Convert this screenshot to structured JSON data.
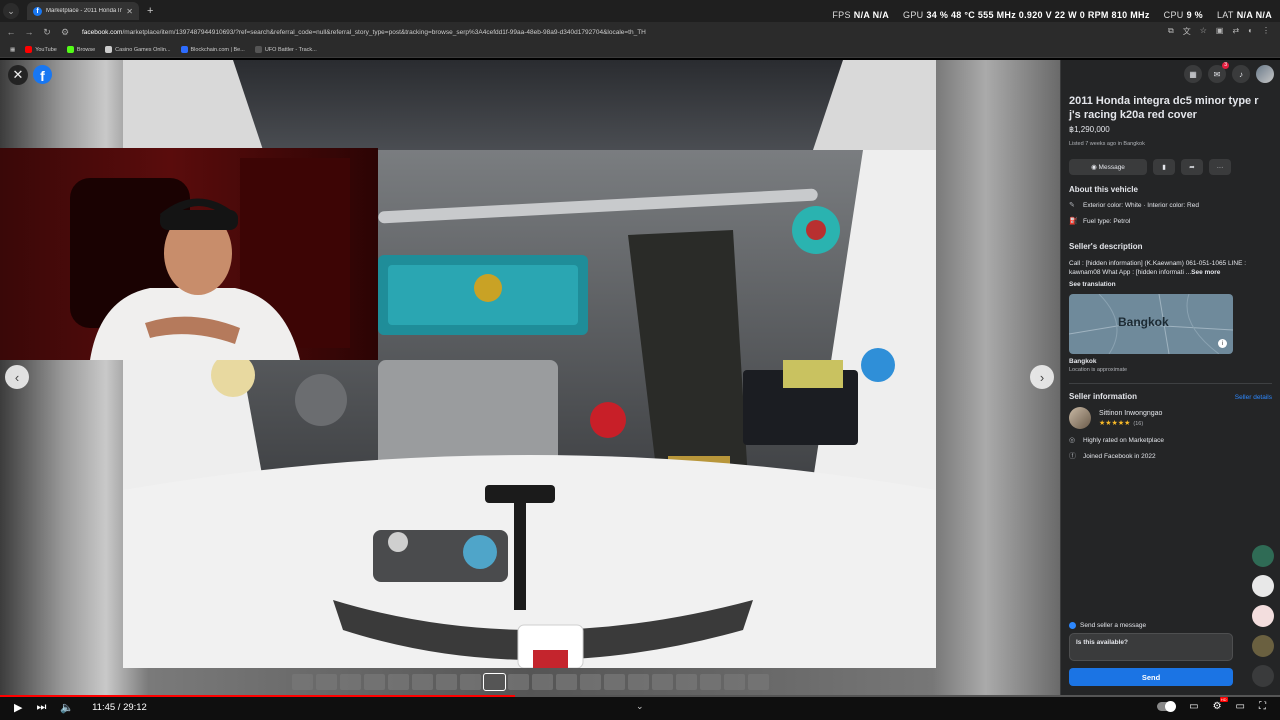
{
  "browser": {
    "tab_title": "Marketplace - 2011 Honda Integ...",
    "url_host": "facebook.com",
    "url_path": "/marketplace/item/1397487944910693/?ref=search&referral_code=null&referral_story_type=post&tracking=browse_serp%3A4cefdd1f-99aa-48eb-98a9-d340d1792704&locale=th_TH",
    "bookmarks": [
      {
        "label": "YouTube",
        "color": "#ff0000"
      },
      {
        "label": "Browse",
        "color": "#53fc18"
      },
      {
        "label": "Casino Games Onlin...",
        "color": "#cccccc"
      },
      {
        "label": "Blockchain.com | Be...",
        "color": "#2d6cff"
      },
      {
        "label": "UFO Battler - Track...",
        "color": "#555555"
      }
    ]
  },
  "perf_overlay": {
    "fps_label": "FPS",
    "fps_value": "N/A N/A",
    "gpu_label": "GPU",
    "gpu_value": "34 % 48 °C 555 MHz 0.920 V 22 W 0 RPM 810 MHz",
    "cpu_label": "CPU",
    "cpu_value": "9 %",
    "lat_label": "LAT",
    "lat_value": "N/A N/A"
  },
  "viewer": {
    "thumbnail_count": 20,
    "selected_thumbnail": 8
  },
  "panel": {
    "notification_count": "3",
    "title": "2011 Honda integra dc5 minor type r j's racing k20a red cover",
    "price": "฿1,290,000",
    "listed": "Listed 7 weeks ago in Bangkok",
    "message_label": "Message",
    "about_title": "About this vehicle",
    "exterior": "Exterior color: White · Interior color: Red",
    "fuel": "Fuel type: Petrol",
    "desc_title": "Seller's description",
    "desc_text": "Call : [hidden information] (K.Kaewnam) 061-051-1065 LINE : kawnam08 What App : [hidden informati ...",
    "see_more": "See more",
    "see_translation": "See translation",
    "map_label": "Bangkok",
    "location_name": "Bangkok",
    "location_sub": "Location is approximate",
    "seller_title": "Seller information",
    "seller_details": "Seller details",
    "seller_name": "Sittinon Inwongngao",
    "rating_stars": "★★★★★",
    "rating_count": "(16)",
    "highly_rated": "Highly rated on Marketplace",
    "joined": "Joined Facebook in 2022",
    "send_check": "Send seller a message",
    "message_text": "Is this available?",
    "send_label": "Send"
  },
  "player": {
    "time": "11:45 / 29:12",
    "progress": 0.402
  }
}
